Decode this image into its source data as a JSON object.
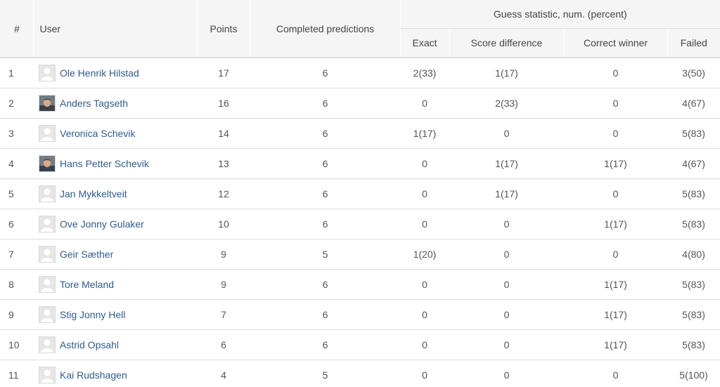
{
  "header": {
    "num": "#",
    "user": "User",
    "points": "Points",
    "completed": "Completed predictions",
    "group": "Guess statistic, num. (percent)",
    "exact": "Exact",
    "score_diff": "Score difference",
    "correct_winner": "Correct winner",
    "failed": "Failed"
  },
  "rows": [
    {
      "num": "1",
      "name": "Ole Henrik Hilstad",
      "avatar": "placeholder",
      "points": "17",
      "completed": "6",
      "exact": "2(33)",
      "score_diff": "1(17)",
      "correct_winner": "0",
      "failed": "3(50)"
    },
    {
      "num": "2",
      "name": "Anders Tagseth",
      "avatar": "photo",
      "points": "16",
      "completed": "6",
      "exact": "0",
      "score_diff": "2(33)",
      "correct_winner": "0",
      "failed": "4(67)"
    },
    {
      "num": "3",
      "name": "Veronica Schevik",
      "avatar": "placeholder",
      "points": "14",
      "completed": "6",
      "exact": "1(17)",
      "score_diff": "0",
      "correct_winner": "0",
      "failed": "5(83)"
    },
    {
      "num": "4",
      "name": "Hans Petter Schevik",
      "avatar": "photo",
      "points": "13",
      "completed": "6",
      "exact": "0",
      "score_diff": "1(17)",
      "correct_winner": "1(17)",
      "failed": "4(67)"
    },
    {
      "num": "5",
      "name": "Jan Mykkeltveit",
      "avatar": "placeholder",
      "points": "12",
      "completed": "6",
      "exact": "0",
      "score_diff": "1(17)",
      "correct_winner": "0",
      "failed": "5(83)"
    },
    {
      "num": "6",
      "name": "Ove Jonny Gulaker",
      "avatar": "placeholder",
      "points": "10",
      "completed": "6",
      "exact": "0",
      "score_diff": "0",
      "correct_winner": "1(17)",
      "failed": "5(83)"
    },
    {
      "num": "7",
      "name": "Geir Sæther",
      "avatar": "placeholder",
      "points": "9",
      "completed": "5",
      "exact": "1(20)",
      "score_diff": "0",
      "correct_winner": "0",
      "failed": "4(80)"
    },
    {
      "num": "8",
      "name": "Tore Meland",
      "avatar": "placeholder",
      "points": "9",
      "completed": "6",
      "exact": "0",
      "score_diff": "0",
      "correct_winner": "1(17)",
      "failed": "5(83)"
    },
    {
      "num": "9",
      "name": "Stig Jonny Hell",
      "avatar": "placeholder",
      "points": "7",
      "completed": "6",
      "exact": "0",
      "score_diff": "0",
      "correct_winner": "1(17)",
      "failed": "5(83)"
    },
    {
      "num": "10",
      "name": "Astrid Opsahl",
      "avatar": "placeholder",
      "points": "6",
      "completed": "6",
      "exact": "0",
      "score_diff": "0",
      "correct_winner": "1(17)",
      "failed": "5(83)"
    },
    {
      "num": "11",
      "name": "Kai Rudshagen",
      "avatar": "placeholder",
      "points": "4",
      "completed": "5",
      "exact": "0",
      "score_diff": "0",
      "correct_winner": "0",
      "failed": "5(100)"
    }
  ],
  "colors": {
    "link": "#2f5d8e",
    "header_bg": "#f5f5f5",
    "divider": "#dddddd"
  }
}
